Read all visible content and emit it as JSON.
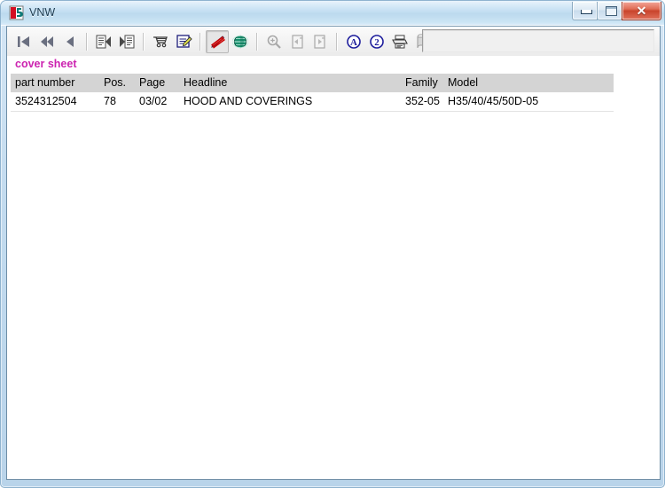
{
  "window": {
    "title": "VNW",
    "icon": "app-logo-icon",
    "controls": [
      {
        "name": "minimize",
        "glyph": "minimize-icon"
      },
      {
        "name": "maximize",
        "glyph": "maximize-icon"
      },
      {
        "name": "close",
        "glyph": "close-icon",
        "label": "✕",
        "color": "#c9442c"
      }
    ]
  },
  "toolbar": {
    "buttons": [
      {
        "name": "go-to-first-icon",
        "kind": "nav-first",
        "state": "enabled"
      },
      {
        "name": "rewind-icon",
        "kind": "nav-rewind",
        "state": "enabled"
      },
      {
        "name": "previous-icon",
        "kind": "nav-prev",
        "state": "enabled"
      },
      {
        "name": "document-previous-icon",
        "kind": "doc-prev",
        "state": "enabled"
      },
      {
        "name": "document-next-icon",
        "kind": "doc-next",
        "state": "enabled"
      },
      {
        "name": "shopping-cart-icon",
        "kind": "cart",
        "state": "enabled"
      },
      {
        "name": "edit-note-icon",
        "kind": "edit-note",
        "state": "enabled"
      },
      {
        "name": "pen-strikethrough-icon",
        "kind": "pen-off",
        "state": "pressed"
      },
      {
        "name": "globe-icon",
        "kind": "globe",
        "state": "enabled"
      },
      {
        "name": "zoom-search-icon",
        "kind": "magnifier",
        "state": "disabled"
      },
      {
        "name": "page-left-icon",
        "kind": "page-left",
        "state": "disabled"
      },
      {
        "name": "page-right-icon",
        "kind": "page-right",
        "state": "disabled"
      },
      {
        "name": "circled-a-icon",
        "kind": "circle-a",
        "state": "enabled"
      },
      {
        "name": "circled-2-icon",
        "kind": "circle-2",
        "state": "enabled"
      },
      {
        "name": "print-icon",
        "kind": "printer",
        "state": "enabled"
      },
      {
        "name": "catalog-book-icon",
        "kind": "book",
        "state": "disabled"
      },
      {
        "name": "stop-icon",
        "kind": "stop-square",
        "state": "enabled"
      }
    ],
    "field_value": ""
  },
  "content": {
    "section_label": "cover sheet",
    "table": {
      "columns": [
        {
          "key": "part_number",
          "label": "part number"
        },
        {
          "key": "pos",
          "label": "Pos."
        },
        {
          "key": "page",
          "label": "Page"
        },
        {
          "key": "headline",
          "label": "Headline"
        },
        {
          "key": "family",
          "label": "Family"
        },
        {
          "key": "model",
          "label": "Model"
        }
      ],
      "rows": [
        {
          "part_number": "3524312504",
          "pos": "78",
          "page": "03/02",
          "headline": "HOOD AND COVERINGS",
          "family": "352-05",
          "model": "H35/40/45/50D-05"
        }
      ]
    }
  },
  "colors": {
    "section_label": "#cc23b0",
    "link": "#2b2bc4",
    "header_bg": "#d4d4d4",
    "title_gradient_top": "#e9f3fb",
    "title_gradient_bottom": "#dfeefa",
    "close_button": "#c9442c"
  }
}
